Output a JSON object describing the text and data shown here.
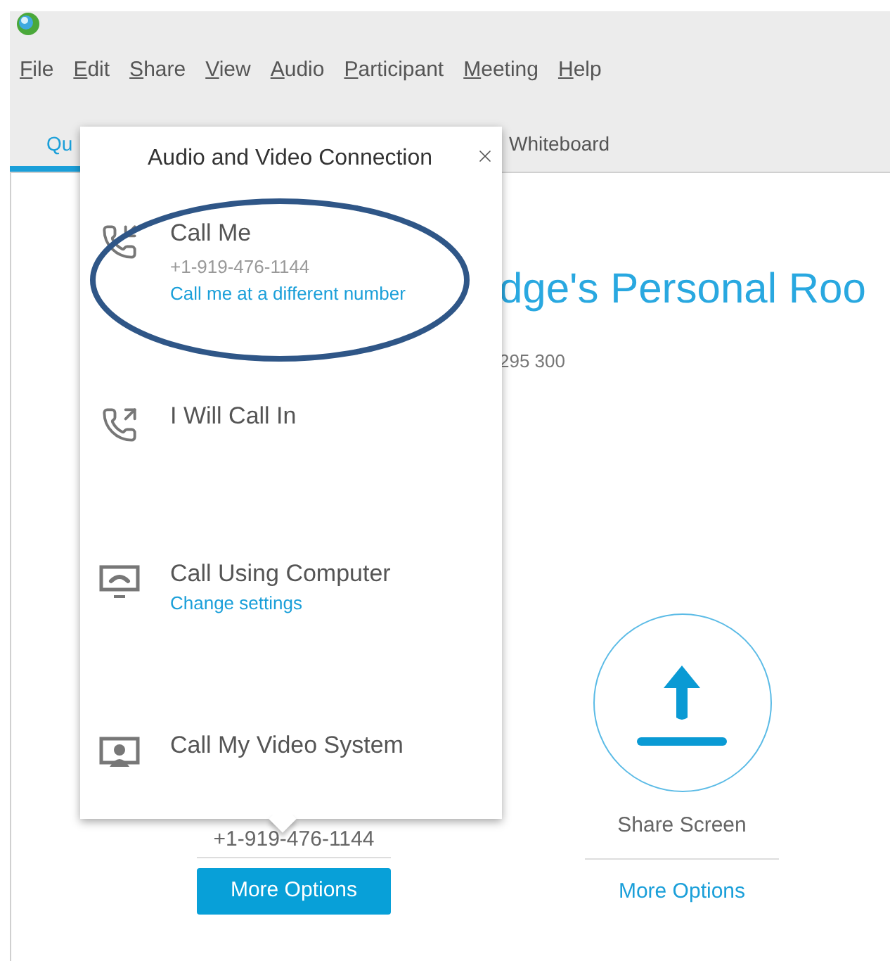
{
  "menu": [
    {
      "label": "File"
    },
    {
      "label": "Edit"
    },
    {
      "label": "Share"
    },
    {
      "label": "View"
    },
    {
      "label": "Audio"
    },
    {
      "label": "Participant"
    },
    {
      "label": "Meeting"
    },
    {
      "label": "Help"
    }
  ],
  "tabs": [
    {
      "label": "Qu",
      "selected": true
    },
    {
      "label": "Whiteboard",
      "selected": false
    }
  ],
  "meeting": {
    "title": "dge's Personal Roo",
    "number": "295 300"
  },
  "audio": {
    "phone": "+1-919-476-1144",
    "button": "More Options"
  },
  "share": {
    "label": "Share Screen",
    "link": "More Options"
  },
  "popup": {
    "title": "Audio and Video Connection",
    "items": [
      {
        "kind": "call_me",
        "label": "Call Me",
        "detail": "+1-919-476-1144",
        "link": "Call me at a different number"
      },
      {
        "kind": "call_in",
        "label": "I Will Call In"
      },
      {
        "kind": "computer",
        "label": "Call Using Computer",
        "link": "Change settings"
      },
      {
        "kind": "video",
        "label": "Call My Video System"
      }
    ]
  }
}
